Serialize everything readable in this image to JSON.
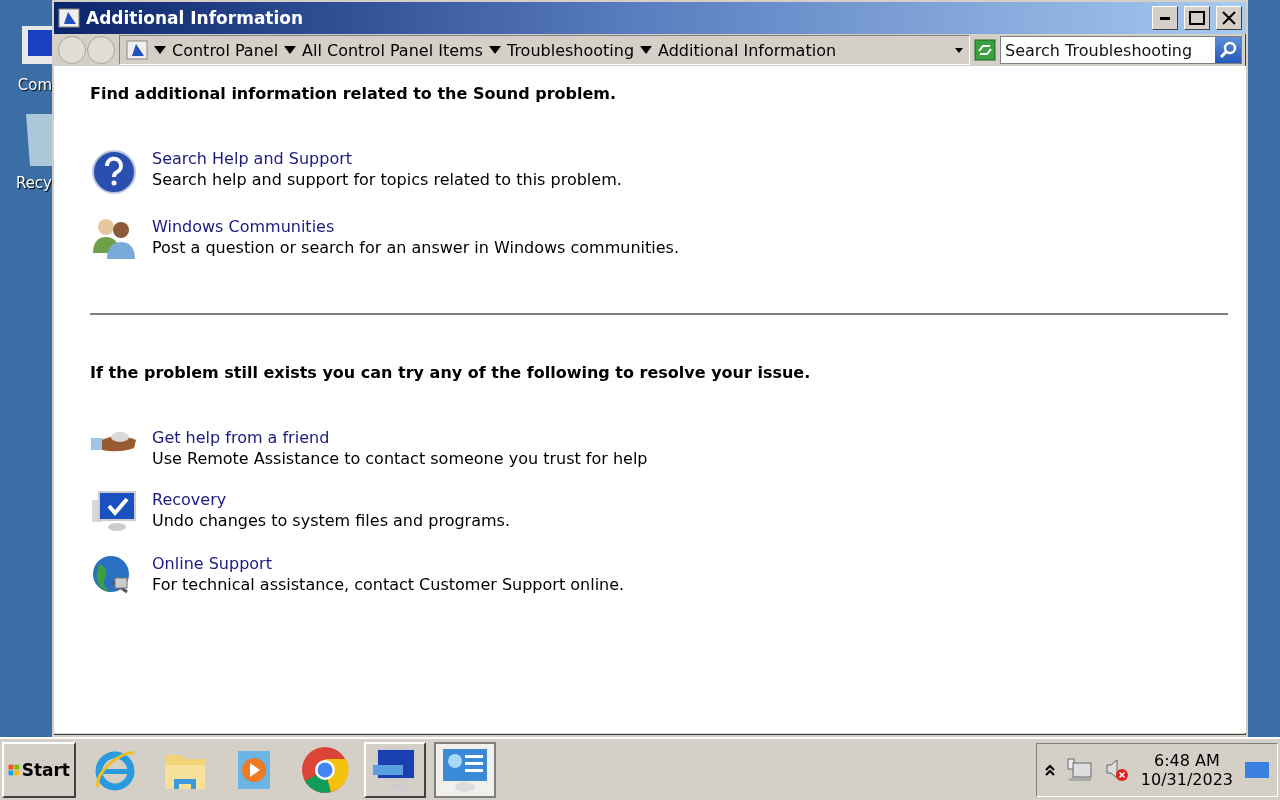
{
  "desktop_icons": [
    {
      "label": "Com"
    },
    {
      "label": "Recy"
    }
  ],
  "window": {
    "title": "Additional Information"
  },
  "address_bar": {
    "breadcrumbs": [
      "Control Panel",
      "All Control Panel Items",
      "Troubleshooting",
      "Additional Information"
    ]
  },
  "search": {
    "placeholder": "Search Troubleshooting"
  },
  "sections": [
    {
      "heading": "Find additional information related to the Sound problem.",
      "items": [
        {
          "title": "Search Help and Support",
          "description": "Search help and support for topics related to this problem."
        },
        {
          "title": "Windows Communities",
          "description": "Post a question or search for an answer in Windows communities."
        }
      ]
    },
    {
      "heading": "If the problem still exists you can try any of the following to resolve your issue.",
      "items": [
        {
          "title": "Get help from a friend",
          "description": "Use Remote Assistance to contact someone you trust for help"
        },
        {
          "title": "Recovery",
          "description": "Undo changes to system files and programs."
        },
        {
          "title": "Online Support",
          "description": "For technical assistance, contact Customer Support online."
        }
      ]
    }
  ],
  "taskbar": {
    "start": "Start",
    "apps": [
      {
        "running": false,
        "selected": false
      },
      {
        "running": false,
        "selected": false
      },
      {
        "running": false,
        "selected": false
      },
      {
        "running": false,
        "selected": false
      },
      {
        "running": true,
        "selected": false
      },
      {
        "running": true,
        "selected": true
      }
    ],
    "clock": {
      "time": "6:48 AM",
      "date": "10/31/2023"
    }
  }
}
